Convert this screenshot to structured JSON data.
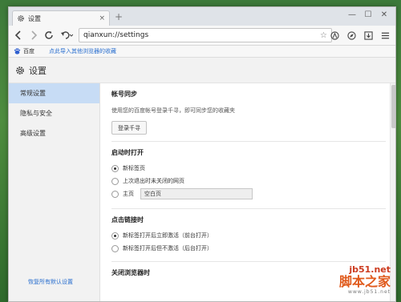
{
  "tab": {
    "title": "设置",
    "close_glyph": "×",
    "icon": "gear-icon"
  },
  "newtab_glyph": "+",
  "window_controls": {
    "minimize": "—",
    "maximize": "☐",
    "close": "✕"
  },
  "address": {
    "url": "qianxun://settings",
    "star_glyph": "☆"
  },
  "bookmarks": {
    "baidu": "百度",
    "import": "点此导入其他浏览器的收藏"
  },
  "settings": {
    "title": "设置",
    "icon": "gear-icon"
  },
  "sidebar": {
    "items": [
      {
        "label": "常规设置",
        "active": true
      },
      {
        "label": "隐私与安全",
        "active": false
      },
      {
        "label": "高级设置",
        "active": false
      }
    ],
    "reset": "恢复所有默认设置"
  },
  "sections": {
    "sync": {
      "title": "帐号同步",
      "desc": "使用您的百度帐号登录千寻，即可同步您的收藏夹",
      "button": "登录千寻"
    },
    "startup": {
      "title": "启动时打开",
      "options": [
        "新标签页",
        "上次退出时未关闭的网页",
        "主页"
      ],
      "homepage_value": "空白页",
      "selected": 0
    },
    "links": {
      "title": "点击链接时",
      "options": [
        "新标签打开后立即激活（前台打开）",
        "新标签打开后但不激活（后台打开）"
      ],
      "selected": 0
    },
    "close": {
      "title": "关闭浏览器时"
    }
  },
  "watermark": {
    "url": "jb51.net",
    "logo": "脚本之家",
    "sub": "www.jb51.net"
  },
  "colors": {
    "accent": "#2a6fcf",
    "active_sidebar": "#c7dcf5"
  }
}
